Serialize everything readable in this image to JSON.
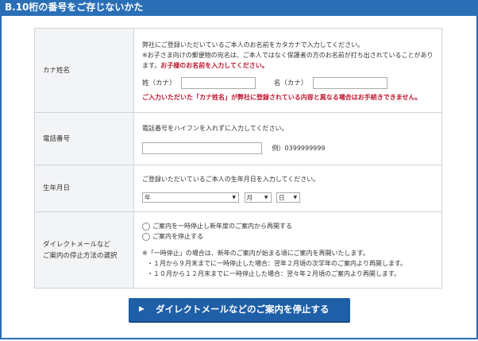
{
  "header": {
    "title": "B.10桁の番号をご存じないかた"
  },
  "rows": {
    "kana": {
      "label": "カナ姓名",
      "desc1": "弊社にご登録いただいているご本人のお名前をカタカナで入力してください。",
      "desc2": "※お子さま向けの郵便物の宛名は、ご本人ではなく保護者の方のお名前が打ち出されていることがあります。",
      "desc2_red": "お子様のお名前を入力してください。",
      "sei_label": "姓（カナ）",
      "mei_label": "名（カナ）",
      "warning": "ご入力いただいた「カナ姓名」が弊社に登録されている内容と異なる場合はお手続きできません。"
    },
    "phone": {
      "label": "電話番号",
      "desc": "電話番号をハイフンを入れずに入力してください。",
      "example": "例）0399999999"
    },
    "birth": {
      "label": "生年月日",
      "desc": "ご登録いただいているご本人の生年月日を入力してください。",
      "year": "年",
      "month": "月",
      "day": "日"
    },
    "stop": {
      "label_line1": "ダイレクトメールなど",
      "label_line2": "ご案内の停止方法の選択",
      "option1": "ご案内を一時停止し新年度のご案内から再開する",
      "option2": "ご案内を停止する",
      "note1": "※「一時停止」の場合は、新年のご案内が始まる頃にご案内を再開いたします。",
      "note2": "・１月から９月末までに一時停止した場合：翌年２月頃の次学年のご案内より再開します。",
      "note3": "・１０月から１２月末までに一時停止した場合：翌々年２月頃のご案内より再開します。"
    }
  },
  "submit": {
    "label": "ダイレクトメールなどのご案内を停止する",
    "icon": "play-triangle-icon"
  },
  "colors": {
    "accent": "#2a6fb6",
    "button": "#1f5fa8",
    "warning": "#c0152e",
    "label_bg": "#f3f4f6"
  }
}
